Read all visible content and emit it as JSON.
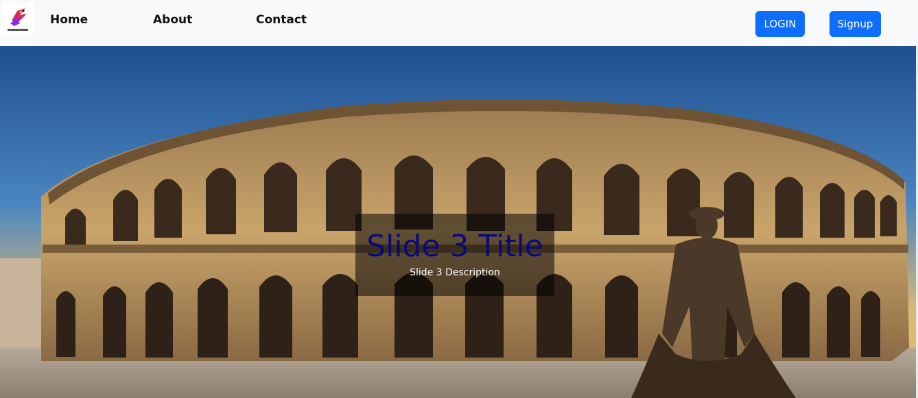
{
  "navbar": {
    "logo_icon": "bird-logo-icon",
    "links": [
      {
        "label": "Home"
      },
      {
        "label": "About"
      },
      {
        "label": "Contact"
      }
    ],
    "login_label": "LOGIN",
    "signup_label": "Signup",
    "button_color": "#0d6efd",
    "background": "#f8f9fa"
  },
  "carousel": {
    "slide_title": "Slide 3 Title",
    "slide_description": "Slide 3 Description",
    "title_color": "#0a0a7a",
    "image_subject": "roman-amphitheater-with-matador-statue"
  }
}
